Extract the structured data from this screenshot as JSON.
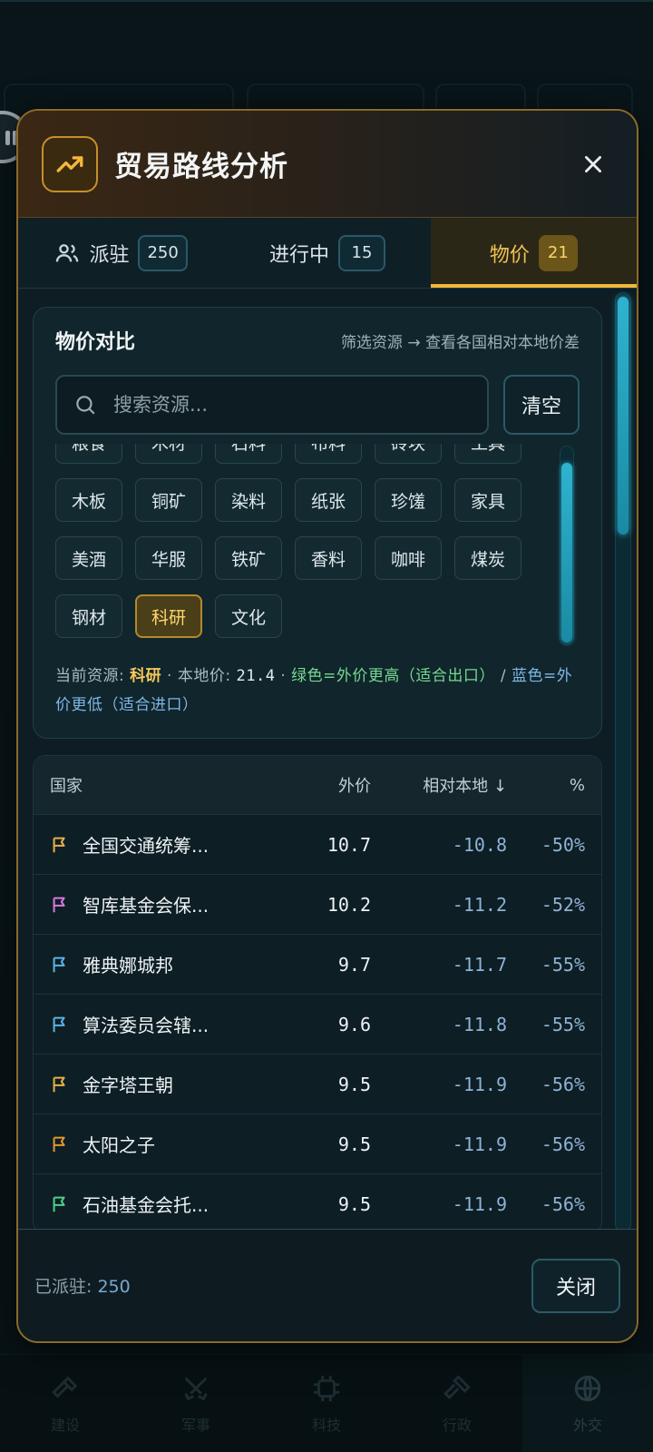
{
  "modal": {
    "title": "贸易路线分析",
    "tabs": [
      {
        "label": "派驻",
        "badge": "250"
      },
      {
        "label": "进行中",
        "badge": "15"
      },
      {
        "label": "物价",
        "badge": "21"
      }
    ],
    "active_tab": "物价"
  },
  "price_card": {
    "title": "物价对比",
    "hint": "筛选资源 → 查看各国相对本地价差",
    "search_placeholder": "搜索资源...",
    "clear_label": "清空",
    "resources": [
      "粮食",
      "木材",
      "石料",
      "布料",
      "砖块",
      "工具",
      "木板",
      "铜矿",
      "染料",
      "纸张",
      "珍馐",
      "家具",
      "美酒",
      "华服",
      "铁矿",
      "香料",
      "咖啡",
      "煤炭",
      "钢材",
      "科研",
      "文化"
    ],
    "selected_resource": "科研",
    "info": {
      "current_label": "当前资源:",
      "current_value": "科研",
      "local_label": "· 本地价:",
      "local_value": "21.4",
      "green_note": "· 绿色=外价更高（适合出口）",
      "blue_note": "/ 蓝色=外价更低（适合进口）"
    }
  },
  "table": {
    "headers": {
      "country": "国家",
      "price": "外价",
      "relative": "相对本地 ↓",
      "pct": "%"
    },
    "rows": [
      {
        "country": "全国交通统筹...",
        "price": "10.7",
        "relative": "-10.8",
        "pct": "-50%",
        "flag_color": "#e8b04a"
      },
      {
        "country": "智库基金会保...",
        "price": "10.2",
        "relative": "-11.2",
        "pct": "-52%",
        "flag_color": "#d77be0"
      },
      {
        "country": "雅典娜城邦",
        "price": "9.7",
        "relative": "-11.7",
        "pct": "-55%",
        "flag_color": "#5ab4e6"
      },
      {
        "country": "算法委员会辖...",
        "price": "9.6",
        "relative": "-11.8",
        "pct": "-55%",
        "flag_color": "#5ab4e6"
      },
      {
        "country": "金字塔王朝",
        "price": "9.5",
        "relative": "-11.9",
        "pct": "-56%",
        "flag_color": "#e8b04a"
      },
      {
        "country": "太阳之子",
        "price": "9.5",
        "relative": "-11.9",
        "pct": "-56%",
        "flag_color": "#e2972e"
      },
      {
        "country": "石油基金会托...",
        "price": "9.5",
        "relative": "-11.9",
        "pct": "-56%",
        "flag_color": "#4fd08a"
      }
    ]
  },
  "footer": {
    "stationed_label": "已派驻:",
    "stationed_value": "250",
    "close_label": "关闭"
  },
  "background_nav": [
    "建设",
    "军事",
    "科技",
    "行政",
    "外交"
  ]
}
